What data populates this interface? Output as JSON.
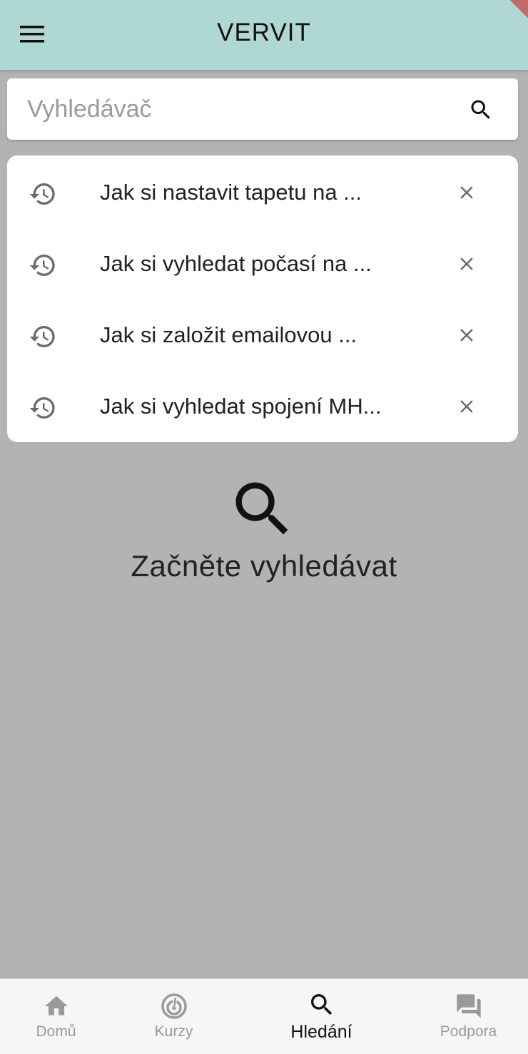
{
  "appbar": {
    "title": "VERVIT",
    "menu_icon": "hamburger-menu-icon"
  },
  "search": {
    "placeholder": "Vyhledávač",
    "value": "",
    "icon": "search-icon"
  },
  "history": {
    "items": [
      {
        "label": "Jak si nastavit tapetu na ...",
        "icon": "history-icon",
        "remove_icon": "close-icon"
      },
      {
        "label": "Jak si vyhledat počasí na ...",
        "icon": "history-icon",
        "remove_icon": "close-icon"
      },
      {
        "label": "Jak si založit emailovou ...",
        "icon": "history-icon",
        "remove_icon": "close-icon"
      },
      {
        "label": "Jak si vyhledat spojení MH...",
        "icon": "history-icon",
        "remove_icon": "close-icon"
      }
    ]
  },
  "empty_state": {
    "icon": "search-icon",
    "text": "Začněte vyhledávat"
  },
  "bottom_nav": {
    "items": [
      {
        "label": "Domů",
        "icon": "home-icon",
        "active": false
      },
      {
        "label": "Kurzy",
        "icon": "courses-icon",
        "active": false
      },
      {
        "label": "Hledání",
        "icon": "search-icon",
        "active": true
      },
      {
        "label": "Podpora",
        "icon": "chat-icon",
        "active": false
      }
    ]
  },
  "colors": {
    "appbar_bg": "#afd8d3",
    "overlay_bg": "#b3b3b3",
    "nav_inactive": "#9a9a9a",
    "nav_active": "#111111"
  }
}
